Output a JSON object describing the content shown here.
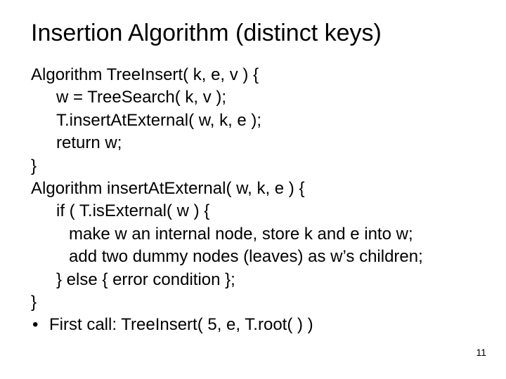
{
  "title": "Insertion Algorithm (distinct keys)",
  "lines": {
    "l1": "Algorithm TreeInsert( k, e, v ) {",
    "l2": "w = TreeSearch( k, v );",
    "l3": "T.insertAtExternal( w, k, e );",
    "l4": "return w;",
    "l5": "}",
    "l6": "Algorithm insertAtExternal( w, k, e ) {",
    "l7": "if ( T.isExternal( w ) {",
    "l8": "make w an internal node, store k and e into w;",
    "l9": "add two dummy nodes (leaves) as w’s children;",
    "l10": "}  else  { error condition };",
    "l11": "}",
    "bullet": "First call: TreeInsert( 5, e, T.root( ) )"
  },
  "bullet_glyph": "•",
  "page_number": "11"
}
